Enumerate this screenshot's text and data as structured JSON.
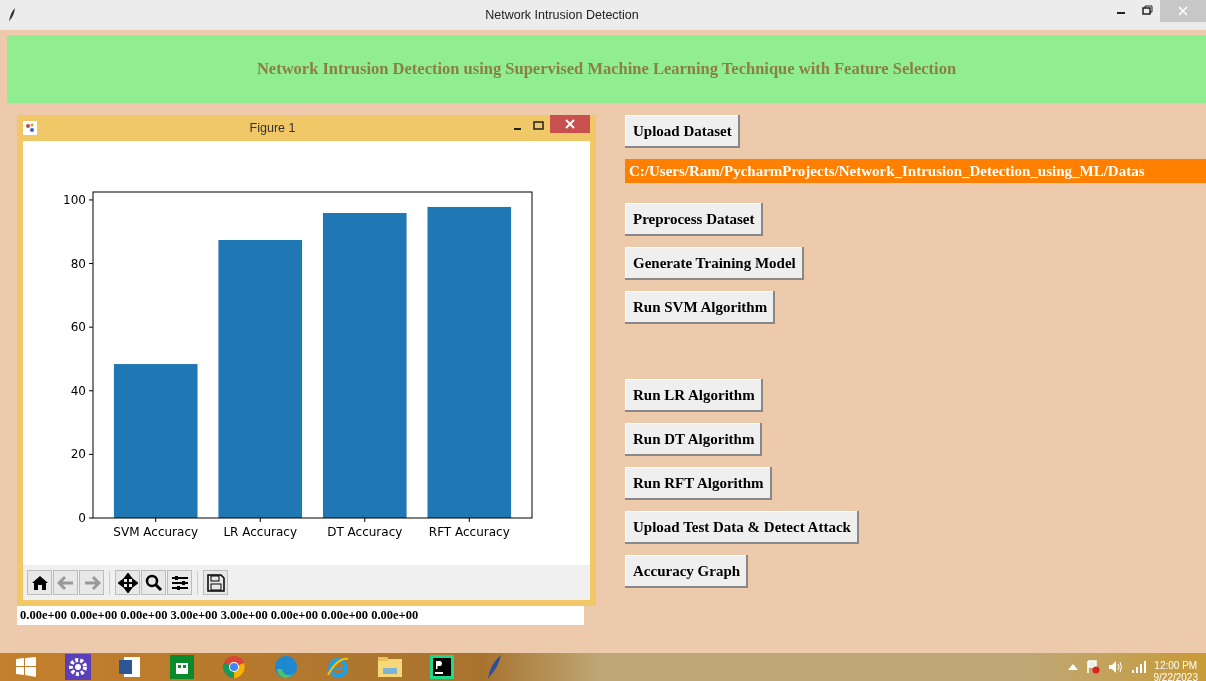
{
  "window": {
    "title": "Network Intrusion Detection"
  },
  "banner": {
    "title": "Network Intrusion Detection using Supervised Machine Learning Technique with Feature Selection"
  },
  "figure": {
    "title": "Figure 1",
    "chart_data": {
      "type": "bar",
      "categories": [
        "SVM Accuracy",
        "LR Accuracy",
        "DT Accuracy",
        "RFT Accuracy"
      ],
      "values": [
        48.4,
        87.4,
        95.9,
        97.8
      ],
      "ylim": [
        0,
        102.5
      ],
      "yticks": [
        0,
        20,
        40,
        60,
        80,
        100
      ]
    },
    "toolbar": [
      {
        "kind": "home",
        "disabled": false
      },
      {
        "kind": "back",
        "disabled": true
      },
      {
        "kind": "forward",
        "disabled": true
      },
      {
        "kind": "pan",
        "disabled": false
      },
      {
        "kind": "zoom",
        "disabled": false
      },
      {
        "kind": "configure",
        "disabled": false
      },
      {
        "kind": "save",
        "disabled": false
      }
    ]
  },
  "output_line": "0.00e+00 0.00e+00 0.00e+00 3.00e+00 3.00e+00 0.00e+00 0.00e+00 0.00e+00",
  "actions": [
    {
      "kind": "button",
      "label": "Upload Dataset"
    },
    {
      "kind": "path",
      "label": "C:/Users/Ram/PycharmProjects/Network_Intrusion_Detection_using_ML/Datas"
    },
    {
      "kind": "button",
      "label": "Preprocess Dataset"
    },
    {
      "kind": "button",
      "label": "Generate Training Model"
    },
    {
      "kind": "button",
      "label": "Run SVM Algorithm"
    },
    {
      "kind": "spacer"
    },
    {
      "kind": "button",
      "label": "Run LR Algorithm"
    },
    {
      "kind": "button",
      "label": "Run DT Algorithm"
    },
    {
      "kind": "button",
      "label": "Run RFT Algorithm"
    },
    {
      "kind": "button",
      "label": "Upload Test Data & Detect Attack"
    },
    {
      "kind": "button",
      "label": "Accuracy Graph"
    }
  ],
  "taskbar": {
    "time": "12:00 PM",
    "date": "9/22/2023"
  }
}
